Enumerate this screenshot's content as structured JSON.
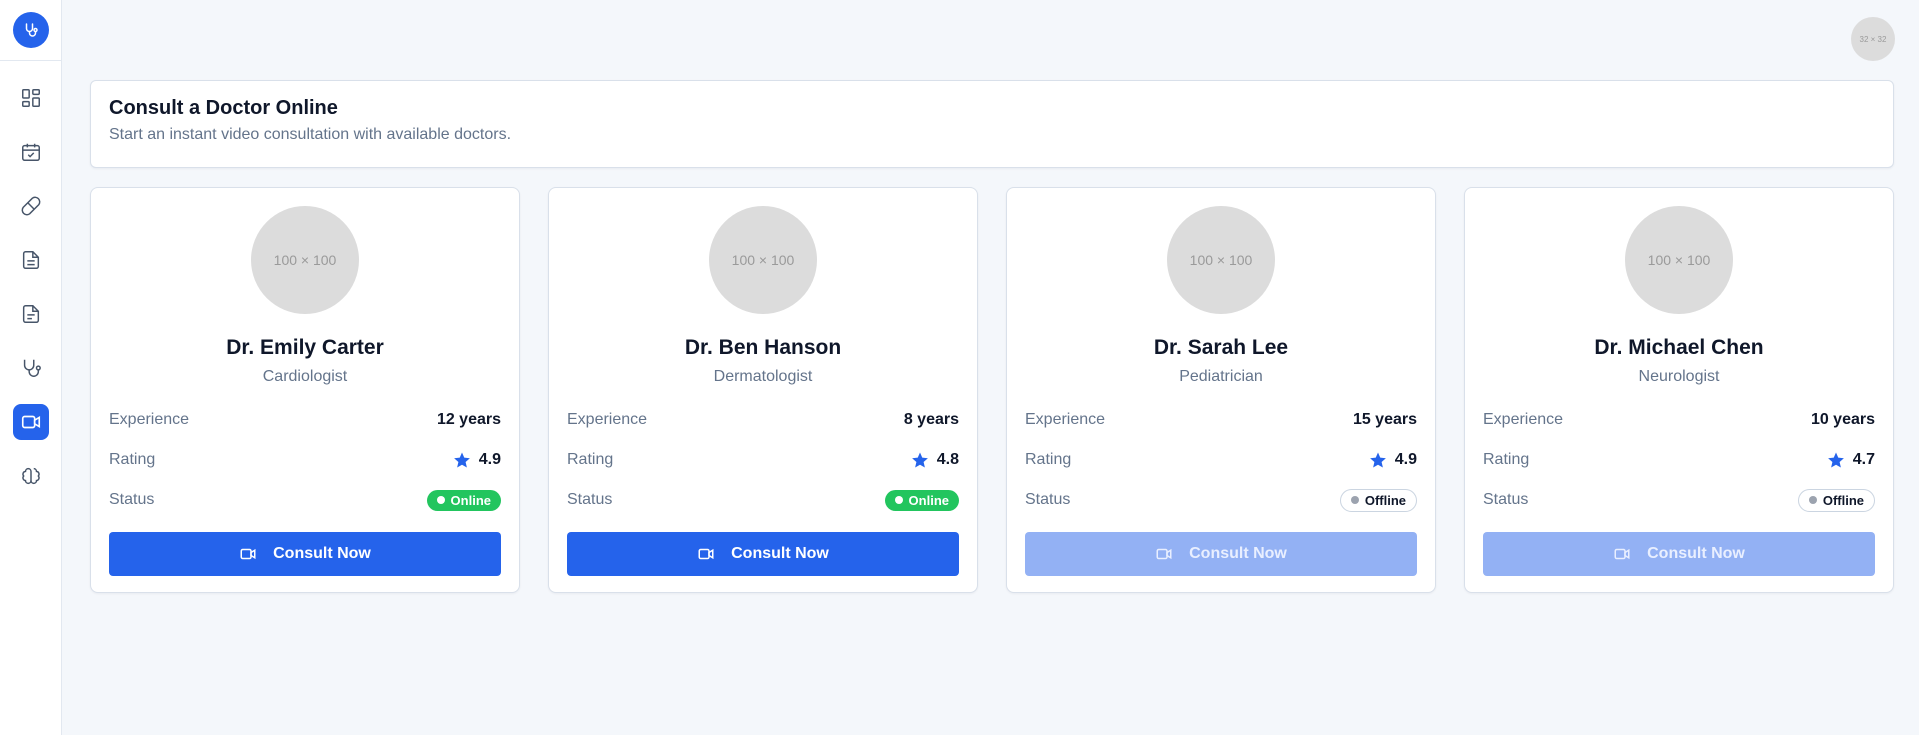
{
  "app": {
    "logo_icon": "stethoscope-logo-icon",
    "accent_color": "#2563eb"
  },
  "sidebar": {
    "items": [
      {
        "icon": "dashboard-icon",
        "active": false
      },
      {
        "icon": "calendar-check-icon",
        "active": false
      },
      {
        "icon": "pill-icon",
        "active": false
      },
      {
        "icon": "document-icon",
        "active": false
      },
      {
        "icon": "report-icon",
        "active": false
      },
      {
        "icon": "stethoscope-icon",
        "active": false
      },
      {
        "icon": "video-icon",
        "active": true
      },
      {
        "icon": "brain-icon",
        "active": false
      }
    ]
  },
  "topbar": {
    "avatar_placeholder": "32 × 32"
  },
  "header": {
    "title": "Consult a Doctor Online",
    "subtitle": "Start an instant video consultation with available doctors."
  },
  "labels": {
    "experience": "Experience",
    "rating": "Rating",
    "status": "Status",
    "consult_button": "Consult Now"
  },
  "doctors": [
    {
      "avatar_placeholder": "100 × 100",
      "name": "Dr. Emily Carter",
      "specialty": "Cardiologist",
      "experience": "12 years",
      "rating": "4.9",
      "status": "Online",
      "available": true
    },
    {
      "avatar_placeholder": "100 × 100",
      "name": "Dr. Ben Hanson",
      "specialty": "Dermatologist",
      "experience": "8 years",
      "rating": "4.8",
      "status": "Online",
      "available": true
    },
    {
      "avatar_placeholder": "100 × 100",
      "name": "Dr. Sarah Lee",
      "specialty": "Pediatrician",
      "experience": "15 years",
      "rating": "4.9",
      "status": "Offline",
      "available": false
    },
    {
      "avatar_placeholder": "100 × 100",
      "name": "Dr. Michael Chen",
      "specialty": "Neurologist",
      "experience": "10 years",
      "rating": "4.7",
      "status": "Offline",
      "available": false
    }
  ]
}
